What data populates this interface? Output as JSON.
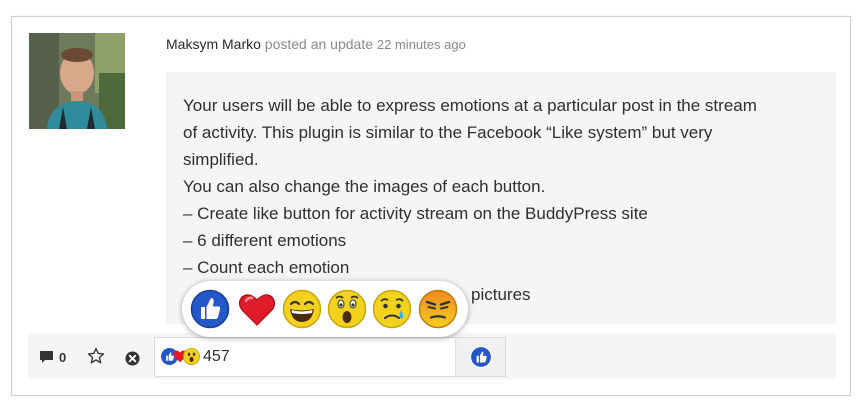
{
  "post": {
    "author": "Maksym Marko",
    "action": "posted an update",
    "time": "22 minutes ago",
    "avatar": "user-photo",
    "lines": [
      "Your users will be able to express emotions at a particular post in the stream",
      "of activity. This plugin is similar to the Facebook “Like system” but very",
      "simplified.",
      "You can also change the images of each button.",
      "– Create like button for activity stream on the BuddyPress site",
      "– 6 different emotions",
      "– Count each emotion",
      "pictures"
    ]
  },
  "actions": {
    "comment_count": "0",
    "comment_icon": "comment-icon",
    "favorite_icon": "star-icon",
    "delete_icon": "close-circle-icon"
  },
  "reactions": {
    "count": "457",
    "summary_icons": [
      "thumbs-up-icon",
      "heart-icon",
      "wow-icon"
    ],
    "popup": [
      "like",
      "love",
      "haha",
      "wow",
      "sad",
      "angry"
    ],
    "like_button_icon": "thumbs-up-icon"
  },
  "colors": {
    "like_blue": "#2458c8",
    "love_red": "#e01c2a",
    "emoji_yellow": "#f3d21e",
    "angry_orange": "#f29a22"
  }
}
